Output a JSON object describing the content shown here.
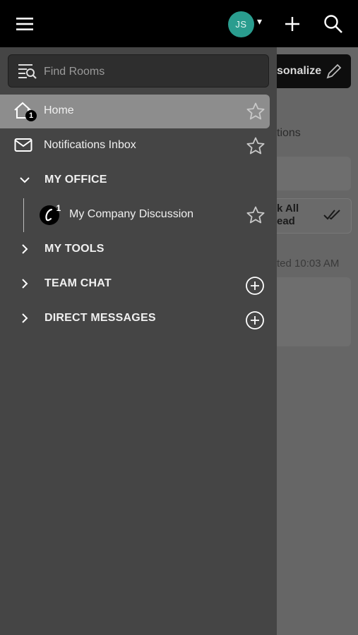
{
  "topbar": {
    "menu_icon": "hamburger-icon",
    "avatar_initials": "JS",
    "avatar_color": "#2a9d8f",
    "avatar_caret": "▾",
    "add_icon": "plus-icon",
    "search_icon": "search-icon"
  },
  "background": {
    "personalize_label": "sonalize",
    "tab_label": "tions",
    "mark_all_line1": "k All",
    "mark_all_line2": "ead",
    "timestamp": "ted 10:03 AM"
  },
  "drawer": {
    "search_placeholder": "Find Rooms",
    "home": {
      "label": "Home",
      "badge": "1"
    },
    "notifications": {
      "label": "Notifications Inbox"
    },
    "my_office": {
      "label": "MY OFFICE"
    },
    "company_discussion": {
      "label": "My Company Discussion",
      "badge": "1"
    },
    "my_tools": {
      "label": "MY TOOLS"
    },
    "team_chat": {
      "label": "TEAM CHAT"
    },
    "direct_messages": {
      "label": "DIRECT MESSAGES"
    }
  }
}
